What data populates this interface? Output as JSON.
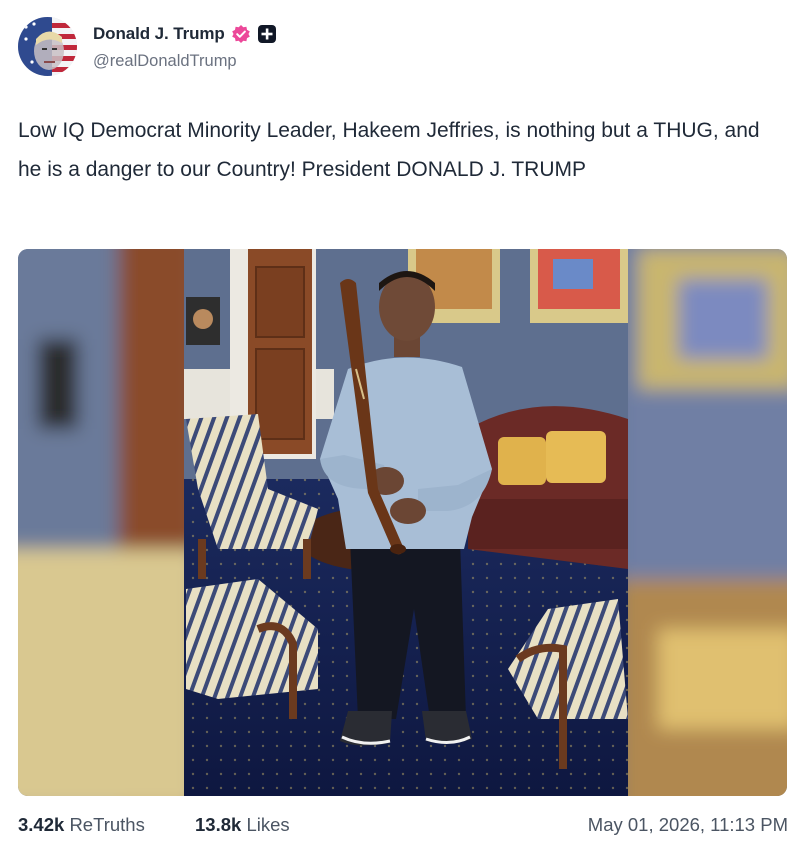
{
  "post": {
    "author": {
      "display_name": "Donald J. Trump",
      "handle": "@realDonaldTrump",
      "verified_icon": "verified-badge-icon",
      "extra_badge_icon": "truth-badge-icon"
    },
    "text": "Low IQ Democrat Minority Leader, Hakeem Jeffries, is nothing but a THUG, and he is a danger to our Country! President DONALD J. TRUMP",
    "media": {
      "type": "photo"
    },
    "stats": {
      "retruths_count": "3.42k",
      "retruths_label": "ReTruths",
      "likes_count": "13.8k",
      "likes_label": "Likes"
    },
    "timestamp": "May 01, 2026, 11:13 PM"
  },
  "colors": {
    "verified_badge": "#ec4899",
    "text_primary": "#1f2937",
    "text_secondary": "#6b7280"
  }
}
